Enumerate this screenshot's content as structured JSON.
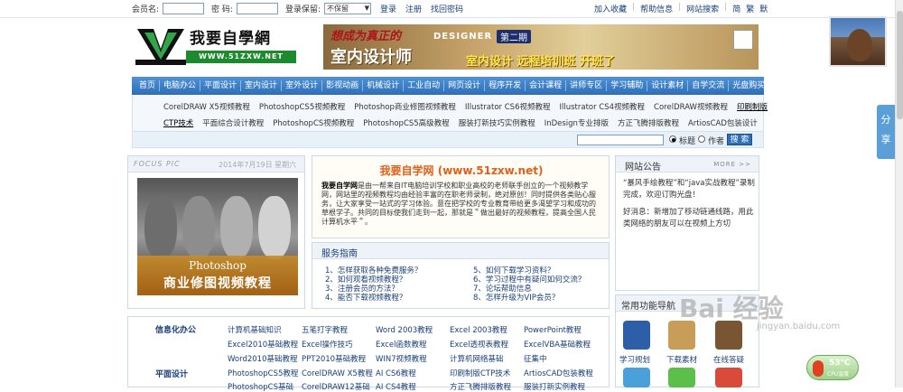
{
  "topbar": {
    "member_label": "会员名:",
    "password_label": "密  码:",
    "keep_label": "登录保留:",
    "keep_value": "不保留",
    "login": "登录",
    "register": "注册",
    "recover": "找回密码",
    "right_links": [
      "加入收藏",
      "帮助信息",
      "网站搜索",
      "简",
      "繁",
      "默"
    ]
  },
  "logo": {
    "text": "我要自學網",
    "url": "WWW.51ZXW.NET"
  },
  "banner": {
    "line1": "想成为真正的",
    "line1b": "DESIGNER",
    "badge": "第二期",
    "line2": "室内设计师",
    "line3": "室内设计 远程培训班 开班了"
  },
  "share": "分享",
  "nav": [
    "首页",
    "电脑办公",
    "平面设计",
    "室内设计",
    "室外设计",
    "影视动画",
    "机械设计",
    "工业自动",
    "网页设计",
    "程序开发",
    "会计课程",
    "讲师专区",
    "学习辅助",
    "设计素材",
    "自学交流",
    "光盘购买"
  ],
  "subnav": {
    "row1": [
      "CorelDRAW X5视频教程",
      "PhotoshopCS5视频教程",
      "Photoshop商业修图视频教程",
      "Illustrator CS6视频教程",
      "Illustrator CS4视频教程",
      "CorelDRAW视频教程",
      "印刷制版"
    ],
    "row2": [
      "CTP技术",
      "平面综合设计教程",
      "PhotoshopCS视频教程",
      "PhotoshopCS5高级教程",
      "服装打新技巧实例教程",
      "InDesign专业排版",
      "方正飞腾排版教程",
      "ArtiosCAD包装设计"
    ]
  },
  "search": {
    "opt1": "标题",
    "opt2": "作者",
    "button": "搜 索"
  },
  "focus": {
    "title": "FOCUS PIC",
    "date": "2014年7月19日 星期六",
    "img_line1": "Photoshop",
    "img_line2": "商业修图视频教程"
  },
  "intro": {
    "title": "我要自学网 (www.51zxw.net)",
    "brand": "我要自学网",
    "body": "是由一帮来自IT电脑培训学校和职业高校的老师联手创立的一个视频教学网，网站里的视频教程均由经验丰富的在职老师录制，绝对原创！同时提供各类贴心服务，让大家享受一站式的学习体验。意在把学校的专业教育带给更多渴望学习和成功的草根学子。共同的目标使我们走到一起，那就是＂做出最好的视频教程，提高全国人民计算机水平＂。"
  },
  "service": {
    "title": "服务指南",
    "left": [
      "1、怎样获取各种免费服务？",
      "2、如何观看视频教程？",
      "3、注册会员的方法？",
      "4、能否下载视频教程？"
    ],
    "right": [
      "5、如何下载学习资料？",
      "6、学习过程中有疑问如何交流？",
      "7、论坛帮助信息",
      "8、怎样升级为VIP会员？"
    ]
  },
  "notice": {
    "title": "网站公告",
    "more": "MORE >>",
    "items": [
      "“暴风手绘教程”和“java实战教程”录制完成，欢迎订购光盘！",
      "好消息：新增加了移动链通线路，用此类网络的朋友可以在视频上方切"
    ]
  },
  "common": {
    "title": "常用功能导航",
    "items": [
      "学习规划",
      "下载素材",
      "在线答疑"
    ]
  },
  "categories": [
    {
      "name": "信息化办公",
      "rows": [
        [
          "计算机基础知识",
          "五笔打字教程",
          "Word 2003教程",
          "Excel 2003教程",
          "PowerPoint教程"
        ],
        [
          "Excel2010基础教程",
          "Excel操作技巧",
          "Excel函数教程",
          "Excel透视表教程",
          "ExcelVBA基础教程"
        ],
        [
          "Word2010基础教程",
          "PPT2010基础教程",
          "WIN7视频教程",
          "计算机网络基础",
          "征集中"
        ]
      ]
    },
    {
      "name": "平面设计",
      "rows": [
        [
          "PhotoshopCS5教程",
          "CorelDRAW X5教程",
          "AI CS6教程",
          "印刷制版CTP技术",
          "ArtiosCAD包装教程"
        ],
        [
          "PhotoshopCS基础",
          "CorelDRAW12基础",
          "AI CS4教程",
          "方正飞腾排版教程",
          "服装打新实例教程"
        ]
      ]
    }
  ],
  "watermark": {
    "text": "Bai 经验",
    "url": "jingyan.baidu.com"
  },
  "cpu": {
    "value": "53℃",
    "label": "CPU温度"
  },
  "colors": {
    "nav": "#2e6fb8",
    "accent": "#e0601a",
    "link": "#1a3f7a"
  }
}
